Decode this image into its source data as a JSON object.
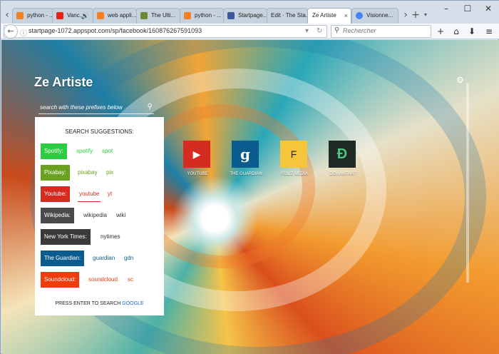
{
  "tabs": [
    {
      "label": "python - ...",
      "favicon_color": "#f48024"
    },
    {
      "label": "Vanc...",
      "favicon_color": "#e62117"
    },
    {
      "label": "web appli...",
      "favicon_color": "#f48024"
    },
    {
      "label": "The Ulti...",
      "favicon_color": "#6a8b2f"
    },
    {
      "label": "python - ...",
      "favicon_color": "#f48024"
    },
    {
      "label": "Startpage...",
      "favicon_color": "#3b5998"
    },
    {
      "label": "Edit · The Sta...",
      "favicon_color": "#cccccc"
    },
    {
      "label": "Ze Artiste",
      "favicon_color": "#ffffff"
    },
    {
      "label": "Visionne...",
      "favicon_color": "#4285f4"
    }
  ],
  "tab_close": "×",
  "new_tab": "+",
  "window_controls": {
    "minimize": "–",
    "maximize": "☐",
    "close": "✕"
  },
  "url": "startpage-1072.appspot.com/sp/facebook/160876267591093",
  "search_placeholder": "Rechercher",
  "toolbar_icons": {
    "add": "+",
    "home": "⌂",
    "download": "⬇",
    "menu": "≡"
  },
  "page": {
    "title": "Ze Artiste",
    "search_placeholder": "search with these prefixes below",
    "panel_title": "SEARCH SUGGESTIONS:",
    "suggestions": [
      {
        "label": "Spotify:",
        "keywords": [
          "spotify",
          "spot"
        ],
        "color": "#2ecc40",
        "text_color": "#2ecc40"
      },
      {
        "label": "Pixabay:",
        "keywords": [
          "pixabay",
          "pix"
        ],
        "color": "#6aa121",
        "text_color": "#6aa121"
      },
      {
        "label": "Youtube:",
        "keywords": [
          "youtube",
          "yt"
        ],
        "color": "#d62b20",
        "text_color": "#d62b20"
      },
      {
        "label": "Wikipedia:",
        "keywords": [
          "wikipedia",
          "wiki"
        ],
        "color": "#4a4a4a",
        "text_color": "#333333"
      },
      {
        "label": "New York Times:",
        "keywords": [
          "nytimes"
        ],
        "color": "#3a3a3a",
        "text_color": "#333333"
      },
      {
        "label": "The Guardian:",
        "keywords": [
          "guardian",
          "gdn"
        ],
        "color": "#0a5c8f",
        "text_color": "#0a5c8f"
      },
      {
        "label": "Soundcloud:",
        "keywords": [
          "soundcloud",
          "sc"
        ],
        "color": "#f03c0c",
        "text_color": "#f03c0c"
      }
    ],
    "footer_prefix": "PRESS ENTER TO SEARCH ",
    "footer_engine": "GOOGLE",
    "tiles": [
      {
        "label": "YOUTUBE",
        "glyph": "▶",
        "color": "#d62b20"
      },
      {
        "label": "THE GUARDIAN",
        "glyph": "g",
        "color": "#0a5c8f"
      },
      {
        "label": "FOLIZ MEDIA",
        "glyph": "F",
        "color": "#f5c63b"
      },
      {
        "label": "DEVIANTART",
        "glyph": "Ɖ",
        "color": "#1f2a25"
      }
    ]
  }
}
